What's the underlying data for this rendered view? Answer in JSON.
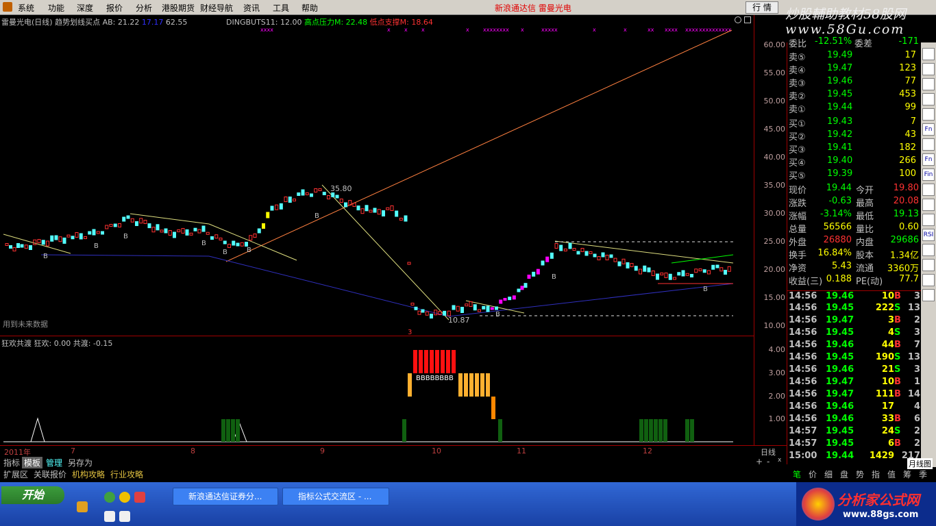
{
  "menu": [
    "系统",
    "功能",
    "深度",
    "报价",
    "分析",
    "港股期货",
    "财经导航",
    "资讯",
    "工具",
    "帮助"
  ],
  "app_title": "新浪通达信  雷曼光电",
  "trade_button": "行 情",
  "brand": {
    "line1": "炒股輔助教材58股网",
    "line2": "www.58Gu.com"
  },
  "main_header": {
    "title": "雷曼光电(日线) 趋势划线买点",
    "ab": "AB: 21.22",
    "v1": "17.17",
    "v2": "62.55",
    "dingbuts": "DINGBUTS11: 12.00",
    "high_pressure": "高点压力M: 22.48",
    "low_support": "低点支撑M: 18.64"
  },
  "main_labels": {
    "peak": "35.80",
    "trough": "10.87",
    "future_note": "用到未来数据",
    "marker": "3"
  },
  "main_axis": [
    "60.00",
    "55.00",
    "50.00",
    "45.00",
    "40.00",
    "35.00",
    "30.00",
    "25.00",
    "20.00",
    "15.00",
    "10.00"
  ],
  "sub_header": {
    "title": "狂欢共渡",
    "kh": "狂欢: 0.00",
    "gd": "共渡: -0.15"
  },
  "sub_axis": [
    "4.00",
    "3.00",
    "2.00",
    "1.00"
  ],
  "date_axis": {
    "labels": [
      "2011年",
      "7",
      "8",
      "9",
      "10",
      "11",
      "12"
    ],
    "period": "日线"
  },
  "tabs1": [
    "指标",
    "模板",
    "管理",
    "另存为"
  ],
  "tabs2": [
    "扩展区",
    "关联报价",
    "机构攻略",
    "行业攻略"
  ],
  "quote": {
    "header": {
      "wb_label": "委比",
      "wb": "-12.51%",
      "wc_label": "委差",
      "wc": "-171"
    },
    "asks": [
      {
        "label": "卖⑤",
        "price": "19.49",
        "vol": "17"
      },
      {
        "label": "卖④",
        "price": "19.47",
        "vol": "123"
      },
      {
        "label": "卖③",
        "price": "19.46",
        "vol": "77"
      },
      {
        "label": "卖②",
        "price": "19.45",
        "vol": "453"
      },
      {
        "label": "卖①",
        "price": "19.44",
        "vol": "99"
      }
    ],
    "bids": [
      {
        "label": "买①",
        "price": "19.43",
        "vol": "7"
      },
      {
        "label": "买②",
        "price": "19.42",
        "vol": "43"
      },
      {
        "label": "买③",
        "price": "19.41",
        "vol": "182"
      },
      {
        "label": "买④",
        "price": "19.40",
        "vol": "266"
      },
      {
        "label": "买⑤",
        "price": "19.39",
        "vol": "100"
      }
    ],
    "stats": [
      {
        "l1": "现价",
        "v1": "19.44",
        "l2": "今开",
        "v2": "19.80"
      },
      {
        "l1": "涨跌",
        "v1": "-0.63",
        "l2": "最高",
        "v2": "20.08"
      },
      {
        "l1": "涨幅",
        "v1": "-3.14%",
        "l2": "最低",
        "v2": "19.13"
      },
      {
        "l1": "总量",
        "v1": "56566",
        "l2": "量比",
        "v2": "0.60"
      },
      {
        "l1": "外盘",
        "v1": "26880",
        "l2": "内盘",
        "v2": "29686"
      },
      {
        "l1": "换手",
        "v1": "16.84%",
        "l2": "股本",
        "v2": "1.34亿"
      },
      {
        "l1": "净资",
        "v1": "5.43",
        "l2": "流通",
        "v2": "3360万"
      },
      {
        "l1": "收益(三)",
        "v1": "0.188",
        "l2": "PE(动)",
        "v2": "77.7"
      }
    ],
    "ticks": [
      {
        "t": "14:56",
        "p": "19.46",
        "v": "10",
        "s": "B",
        "n": "3"
      },
      {
        "t": "14:56",
        "p": "19.45",
        "v": "222",
        "s": "S",
        "n": "13"
      },
      {
        "t": "14:56",
        "p": "19.47",
        "v": "3",
        "s": "B",
        "n": "2"
      },
      {
        "t": "14:56",
        "p": "19.45",
        "v": "4",
        "s": "S",
        "n": "3"
      },
      {
        "t": "14:56",
        "p": "19.46",
        "v": "44",
        "s": "B",
        "n": "7"
      },
      {
        "t": "14:56",
        "p": "19.45",
        "v": "190",
        "s": "S",
        "n": "13"
      },
      {
        "t": "14:56",
        "p": "19.46",
        "v": "21",
        "s": "S",
        "n": "3"
      },
      {
        "t": "14:56",
        "p": "19.47",
        "v": "10",
        "s": "B",
        "n": "1"
      },
      {
        "t": "14:56",
        "p": "19.47",
        "v": "111",
        "s": "B",
        "n": "14"
      },
      {
        "t": "14:56",
        "p": "19.46",
        "v": "17",
        "s": "",
        "n": "4"
      },
      {
        "t": "14:56",
        "p": "19.46",
        "v": "33",
        "s": "B",
        "n": "6"
      },
      {
        "t": "14:57",
        "p": "19.45",
        "v": "24",
        "s": "S",
        "n": "2"
      },
      {
        "t": "14:57",
        "p": "19.45",
        "v": "6",
        "s": "B",
        "n": "2"
      },
      {
        "t": "15:00",
        "p": "19.44",
        "v": "1429",
        "s": "",
        "n": "217"
      }
    ]
  },
  "bottom_tabs": [
    "笔",
    "价",
    "细",
    "盘",
    "势",
    "指",
    "值",
    "筹",
    "季"
  ],
  "month_chart_label": "月线图",
  "side_tools": [
    "",
    "",
    "",
    "",
    "",
    "Fn",
    "",
    "Fn",
    "Fin",
    "",
    "",
    "",
    "RSI",
    "",
    "",
    "",
    ""
  ],
  "taskbar": {
    "start": "开始",
    "tasks": [
      "新浪通达信证券分...",
      "指标公式交流区 - ..."
    ],
    "footer_brand": "分析家公式网",
    "footer_url": "www.88gs.com"
  },
  "colors": {
    "up": "#ff3232",
    "down": "#54ffff",
    "green": "#00ff00",
    "orange": "#ff8040",
    "yellow": "#ffff00",
    "magenta": "#ff00ff"
  }
}
